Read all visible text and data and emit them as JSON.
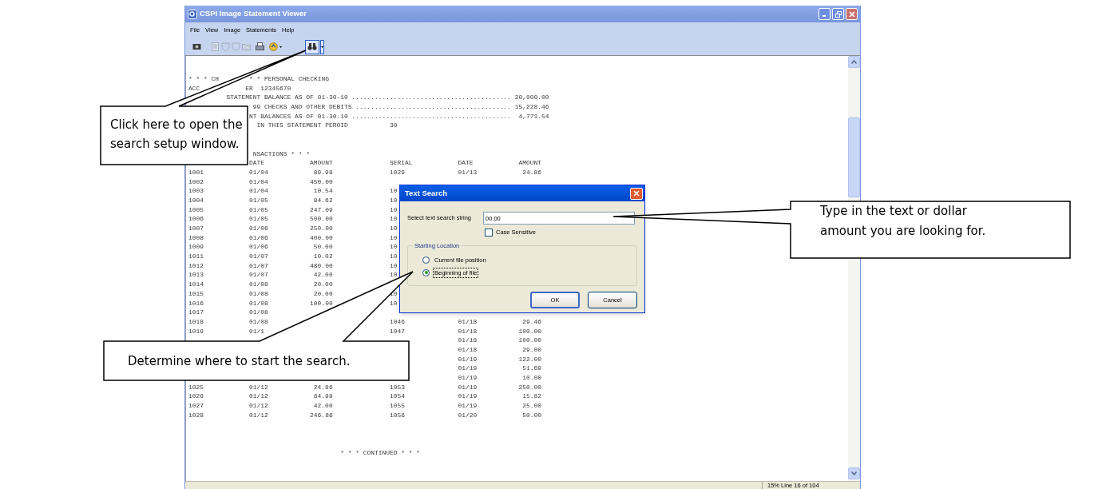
{
  "window": {
    "title": "CSPI Image Statement Viewer"
  },
  "menu": [
    "File",
    "View",
    "Image",
    "Statements",
    "Help"
  ],
  "toolbar": [
    {
      "disabled": false,
      "selected": false
    },
    {
      "disabled": true,
      "selected": false
    },
    {
      "disabled": true,
      "selected": false
    },
    {
      "disabled": true,
      "selected": false
    },
    {
      "disabled": true,
      "selected": false
    },
    {
      "disabled": false,
      "selected": false
    },
    {
      "disabled": false,
      "selected": false
    },
    {
      "disabled": false,
      "selected": true
    }
  ],
  "statement": {
    "lines": [
      {
        "parts": [
          "* * * CH",
          "* * PERSONAL CHECKING"
        ]
      },
      {
        "parts": [
          "ACC",
          "ER",
          "12345670"
        ]
      },
      {
        "parts": [
          "STATEMENT BALANCE AS OF 01-30-10 .......................................... 20,000.00"
        ]
      },
      {
        "parts": [
          "99 CHECKS AND OTHER DEBITS ......................................... 15,228.46"
        ]
      },
      {
        "parts": [
          "NT BALANCES AS OF 01-30-10 ..........................................  4,771.54"
        ]
      },
      {
        "parts": [
          "IN THIS STATEMENT PEROID",
          "30"
        ]
      }
    ],
    "section": "NSACTIONS * * *",
    "header": [
      "DATE",
      "AMOUNT",
      "SERIAL",
      "DATE",
      "AMOUNT"
    ],
    "rows": [
      {
        "serial": "1001",
        "date": "01/04",
        "amount": "89.98",
        "serial_2": "1029",
        "date_2": "01/13",
        "amount_2": "24.86"
      },
      {
        "serial": "1002",
        "date": "01/04",
        "amount": "450.00"
      },
      {
        "serial": "1003",
        "date": "01/04",
        "amount": "10.54",
        "serial_2": "10"
      },
      {
        "serial": "1004",
        "date": "01/05",
        "amount": "84.62",
        "serial_2": "10"
      },
      {
        "serial": "1005",
        "date": "01/05",
        "amount": "247.09",
        "serial_2": "10"
      },
      {
        "serial": "1006",
        "date": "01/05",
        "amount": "500.00",
        "serial_2": "10"
      },
      {
        "serial": "1007",
        "date": "01/06",
        "amount": "250.00",
        "serial_2": "10"
      },
      {
        "serial": "1008",
        "date": "01/06",
        "amount": "400.00",
        "serial_2": "10"
      },
      {
        "serial": "1009",
        "date": "01/06",
        "amount": "50.00",
        "serial_2": "10"
      },
      {
        "serial": "1011",
        "date": "01/07",
        "amount": "10.02",
        "serial_2": "10"
      },
      {
        "serial": "1012",
        "date": "01/07",
        "amount": "480.00",
        "serial_2": "10"
      },
      {
        "serial": "1013",
        "date": "01/07",
        "amount": "42.00",
        "serial_2": "10"
      },
      {
        "serial": "1014",
        "date": "01/08",
        "amount": "20.00"
      },
      {
        "serial": "1015",
        "date": "01/08",
        "amount": "20.00",
        "serial_2": "10"
      },
      {
        "serial": "1016",
        "date": "01/08",
        "amount": "100.00",
        "serial_2": "10"
      },
      {
        "serial": "1017",
        "date": "01/08"
      },
      {
        "serial": "1018",
        "date": "01/08",
        "serial_2": "1046",
        "date_2": "01/18",
        "amount_2": "29.46"
      },
      {
        "serial": "1019",
        "date": "01/1",
        "serial_2": "1047",
        "date_2": "01/18",
        "amount_2": "100.00"
      },
      {
        "date_2": "01/18",
        "amount_2": "100.00"
      },
      {
        "date_2": "01/18",
        "amount_2": "29.00"
      },
      {
        "date_2": "01/19",
        "amount_2": "122.00"
      },
      {
        "date_2": "01/19",
        "amount_2": "51.69"
      },
      {
        "date_2": "01/19",
        "amount_2": "10.00"
      },
      {
        "serial": "1025",
        "date": "01/12",
        "amount": "24.86",
        "serial_2": "1053",
        "date_2": "01/19",
        "amount_2": "250.00"
      },
      {
        "serial": "1026",
        "date": "01/12",
        "amount": "84.99",
        "serial_2": "1054",
        "date_2": "01/19",
        "amount_2": "15.82"
      },
      {
        "serial": "1027",
        "date": "01/12",
        "amount": "42.00",
        "serial_2": "1055",
        "date_2": "01/19",
        "amount_2": "25.00"
      },
      {
        "serial": "1028",
        "date": "01/12",
        "amount": "246.86",
        "serial_2": "1056",
        "date_2": "01/20",
        "amount_2": "50.00"
      }
    ],
    "footer": "* * * CONTINUED * * *"
  },
  "status_bar": {
    "position": "15% Line 16 of 104"
  },
  "dialog": {
    "title": "Text Search",
    "field_label": "Select text search string",
    "search_value": "00.00",
    "case_sensitive": {
      "label": "Case Sensitive",
      "checked": false
    },
    "group_title": "Starting Location",
    "options": [
      {
        "label": "Current file position",
        "selected": false
      },
      {
        "label": "Beginning of file",
        "selected": true
      }
    ],
    "buttons": [
      "OK",
      "Cancel"
    ]
  },
  "callouts": [
    {
      "text": "Click here to open the search setup window."
    },
    {
      "text": "Type in the text or dollar amount you are looking for."
    },
    {
      "text": "Determine where to start the search."
    }
  ]
}
